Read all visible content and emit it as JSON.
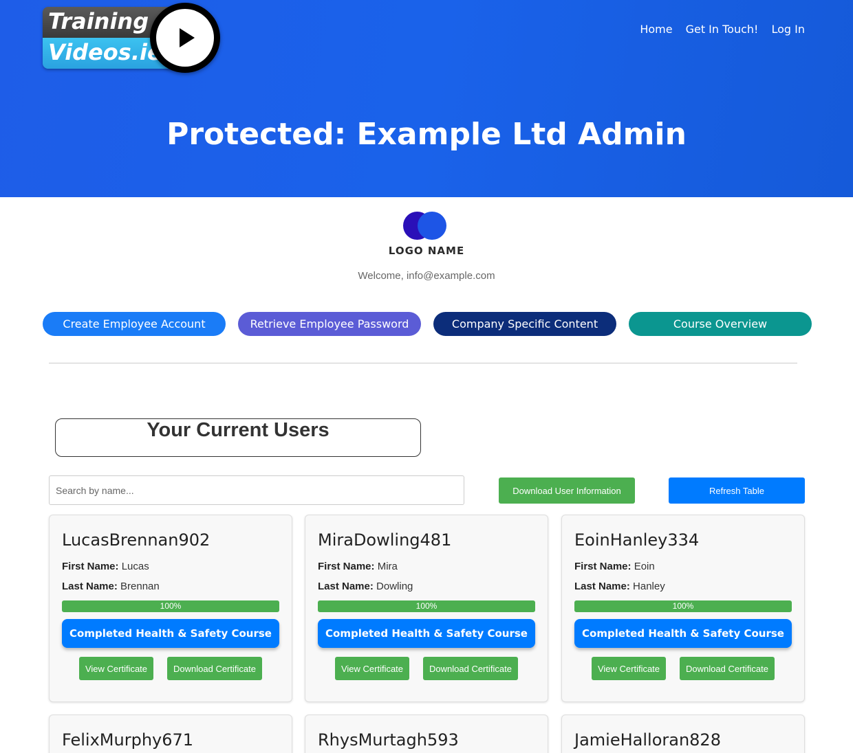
{
  "brand": {
    "line1": "Training",
    "line2": "Videos.ie"
  },
  "nav": {
    "home": "Home",
    "contact": "Get In Touch!",
    "login": "Log In"
  },
  "page_title": "Protected: Example Ltd Admin",
  "company": {
    "logo_name": "LOGO NAME",
    "welcome": "Welcome, info@example.com"
  },
  "actions": [
    {
      "label": "Create Employee Account",
      "color": "#1a7cf7"
    },
    {
      "label": "Retrieve Employee Password",
      "color": "#5b5cd6"
    },
    {
      "label": "Company Specific Content",
      "color": "#0c2d7a"
    },
    {
      "label": "Course Overview",
      "color": "#0b9690"
    }
  ],
  "users_section": {
    "title": "Your Current Users",
    "search_placeholder": "Search by name...",
    "download_label": "Download User Information",
    "refresh_label": "Refresh Table"
  },
  "labels": {
    "first_name": "First Name:",
    "last_name": "Last Name:"
  },
  "users": [
    {
      "username": "LucasBrennan902",
      "first": "Lucas",
      "last": "Brennan",
      "progress": "100%",
      "course": "Completed Health & Safety Course",
      "view": "View Certificate",
      "download": "Download Certificate"
    },
    {
      "username": "MiraDowling481",
      "first": "Mira",
      "last": "Dowling",
      "progress": "100%",
      "course": "Completed Health & Safety Course",
      "view": "View Certificate",
      "download": "Download Certificate"
    },
    {
      "username": "EoinHanley334",
      "first": "Eoin",
      "last": "Hanley",
      "progress": "100%",
      "course": "Completed Health & Safety Course",
      "view": "View Certificate",
      "download": "Download Certificate"
    },
    {
      "username": "FelixMurphy671"
    },
    {
      "username": "RhysMurtagh593"
    },
    {
      "username": "JamieHalloran828"
    }
  ]
}
